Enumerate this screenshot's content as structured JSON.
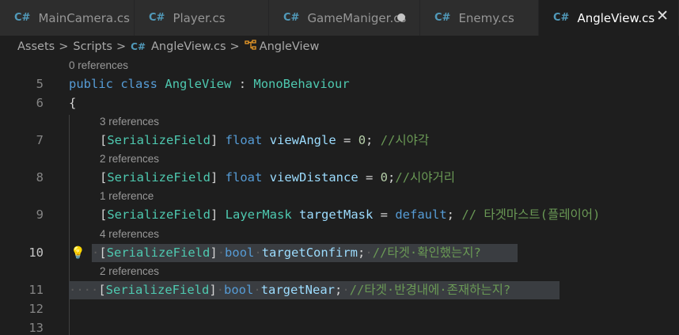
{
  "tabs": [
    {
      "label": "MainCamera.cs",
      "icon": "csharp-icon",
      "active": false
    },
    {
      "label": "Player.cs",
      "icon": "csharp-icon",
      "active": false
    },
    {
      "label": "GameManiger.cs",
      "icon": "csharp-icon",
      "active": false,
      "modified": true
    },
    {
      "label": "Enemy.cs",
      "icon": "csharp-icon",
      "active": false
    },
    {
      "label": "AngleView.cs",
      "icon": "csharp-icon",
      "active": true
    }
  ],
  "tab_icon_glyph": "C#",
  "close_glyph": "✕",
  "breadcrumb": {
    "items": [
      "Assets",
      "Scripts",
      "AngleView.cs",
      "AngleView"
    ],
    "separator": ">"
  },
  "codelens": {
    "l5": "0 references",
    "l7": "3 references",
    "l8": "2 references",
    "l9": "1 reference",
    "l10": "4 references",
    "l11": "2 references"
  },
  "line_numbers": [
    "5",
    "6",
    "7",
    "8",
    "9",
    "10",
    "11",
    "12",
    "13"
  ],
  "code": {
    "l5": {
      "kw1": "public",
      "kw2": "class",
      "name": "AngleView",
      "colon": " : ",
      "base": "MonoBehaviour"
    },
    "l6": {
      "brace": "{"
    },
    "l7": {
      "attr": "SerializeField",
      "type": "float",
      "name": "viewAngle",
      "eq": " = ",
      "val": "0",
      "semi": ";",
      "comment": "//시야각"
    },
    "l8": {
      "attr": "SerializeField",
      "type": "float",
      "name": "viewDistance",
      "eq": " = ",
      "val": "0",
      "semi": ";",
      "comment": "//시야거리"
    },
    "l9": {
      "attr": "SerializeField",
      "type": "LayerMask",
      "name": "targetMask",
      "eq": " = ",
      "val": "default",
      "semi": ";",
      "comment": "// 타겟마스트(플레이어)"
    },
    "l10": {
      "attr": "SerializeField",
      "type": "bool",
      "name": "targetConfirm",
      "semi": ";",
      "comment": "//타겟·확인했는지?"
    },
    "l11": {
      "attr": "SerializeField",
      "type": "bool",
      "name": "targetNear",
      "semi": ";",
      "comment": "//타겟·반경내에·존재하는지?"
    }
  },
  "lightbulb_glyph": "💡",
  "colors": {
    "keyword": "#569cd6",
    "type": "#4ec9b0",
    "variable": "#9cdcfe",
    "number": "#b5cea8",
    "comment": "#6a9955",
    "background": "#1e1e1e",
    "tab_inactive": "#2d2d2d",
    "selection": "#3a3d41"
  }
}
